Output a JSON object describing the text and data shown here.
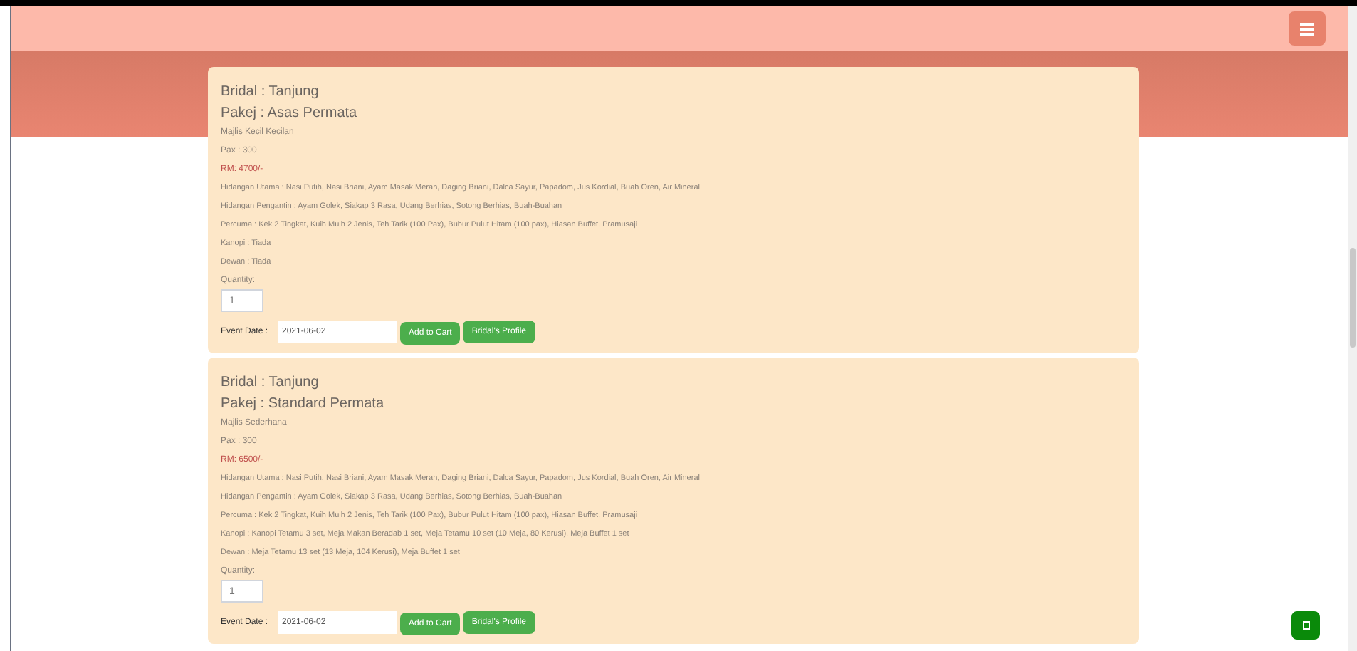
{
  "packages": [
    {
      "bridal": "Bridal : Tanjung",
      "package": "Pakej : Asas Permata",
      "venue": "Majlis Kecil Kecilan",
      "pax": "Pax : 300",
      "price": "RM: 4700/-",
      "details": [
        "Hidangan Utama : Nasi Putih, Nasi Briani, Ayam Masak Merah, Daging Briani, Dalca Sayur, Papadom, Jus Kordial, Buah Oren, Air Mineral",
        "Hidangan Pengantin : Ayam Golek, Siakap 3 Rasa, Udang Berhias, Sotong Berhias, Buah-Buahan",
        "Percuma : Kek 2 Tingkat, Kuih Muih 2 Jenis, Teh Tarik (100 Pax), Bubur Pulut Hitam (100 pax), Hiasan Buffet, Pramusaji",
        "Kanopi : Tiada",
        "Dewan : Tiada"
      ],
      "quantity_label": "Quantity:",
      "quantity": "1",
      "date_label": "Event Date :",
      "date": "2021-06-02",
      "buttons": [
        "Add to Cart",
        "Bridal's Profile"
      ]
    },
    {
      "bridal": "Bridal : Tanjung",
      "package": "Pakej : Standard Permata",
      "venue": "Majlis Sederhana",
      "pax": "Pax : 300",
      "price": "RM: 6500/-",
      "details": [
        "Hidangan Utama : Nasi Putih, Nasi Briani, Ayam Masak Merah, Daging Briani, Dalca Sayur, Papadom, Jus Kordial, Buah Oren, Air Mineral",
        "Hidangan Pengantin : Ayam Golek, Siakap 3 Rasa, Udang Berhias, Sotong Berhias, Buah-Buahan",
        "Percuma : Kek 2 Tingkat, Kuih Muih 2 Jenis, Teh Tarik (100 Pax), Bubur Pulut Hitam (100 pax), Hiasan Buffet, Pramusaji",
        "Kanopi : Kanopi Tetamu 3 set, Meja Makan Beradab 1 set, Meja Tetamu 10 set (10 Meja, 80 Kerusi), Meja Buffet 1 set",
        "Dewan : Meja Tetamu 13 set (13 Meja, 104 Kerusi), Meja Buffet 1 set"
      ],
      "quantity_label": "Quantity:",
      "quantity": "1",
      "date_label": "Event Date :",
      "date": "2021-06-02",
      "buttons": [
        "Add to Cart",
        "Bridal's Profile"
      ]
    }
  ]
}
